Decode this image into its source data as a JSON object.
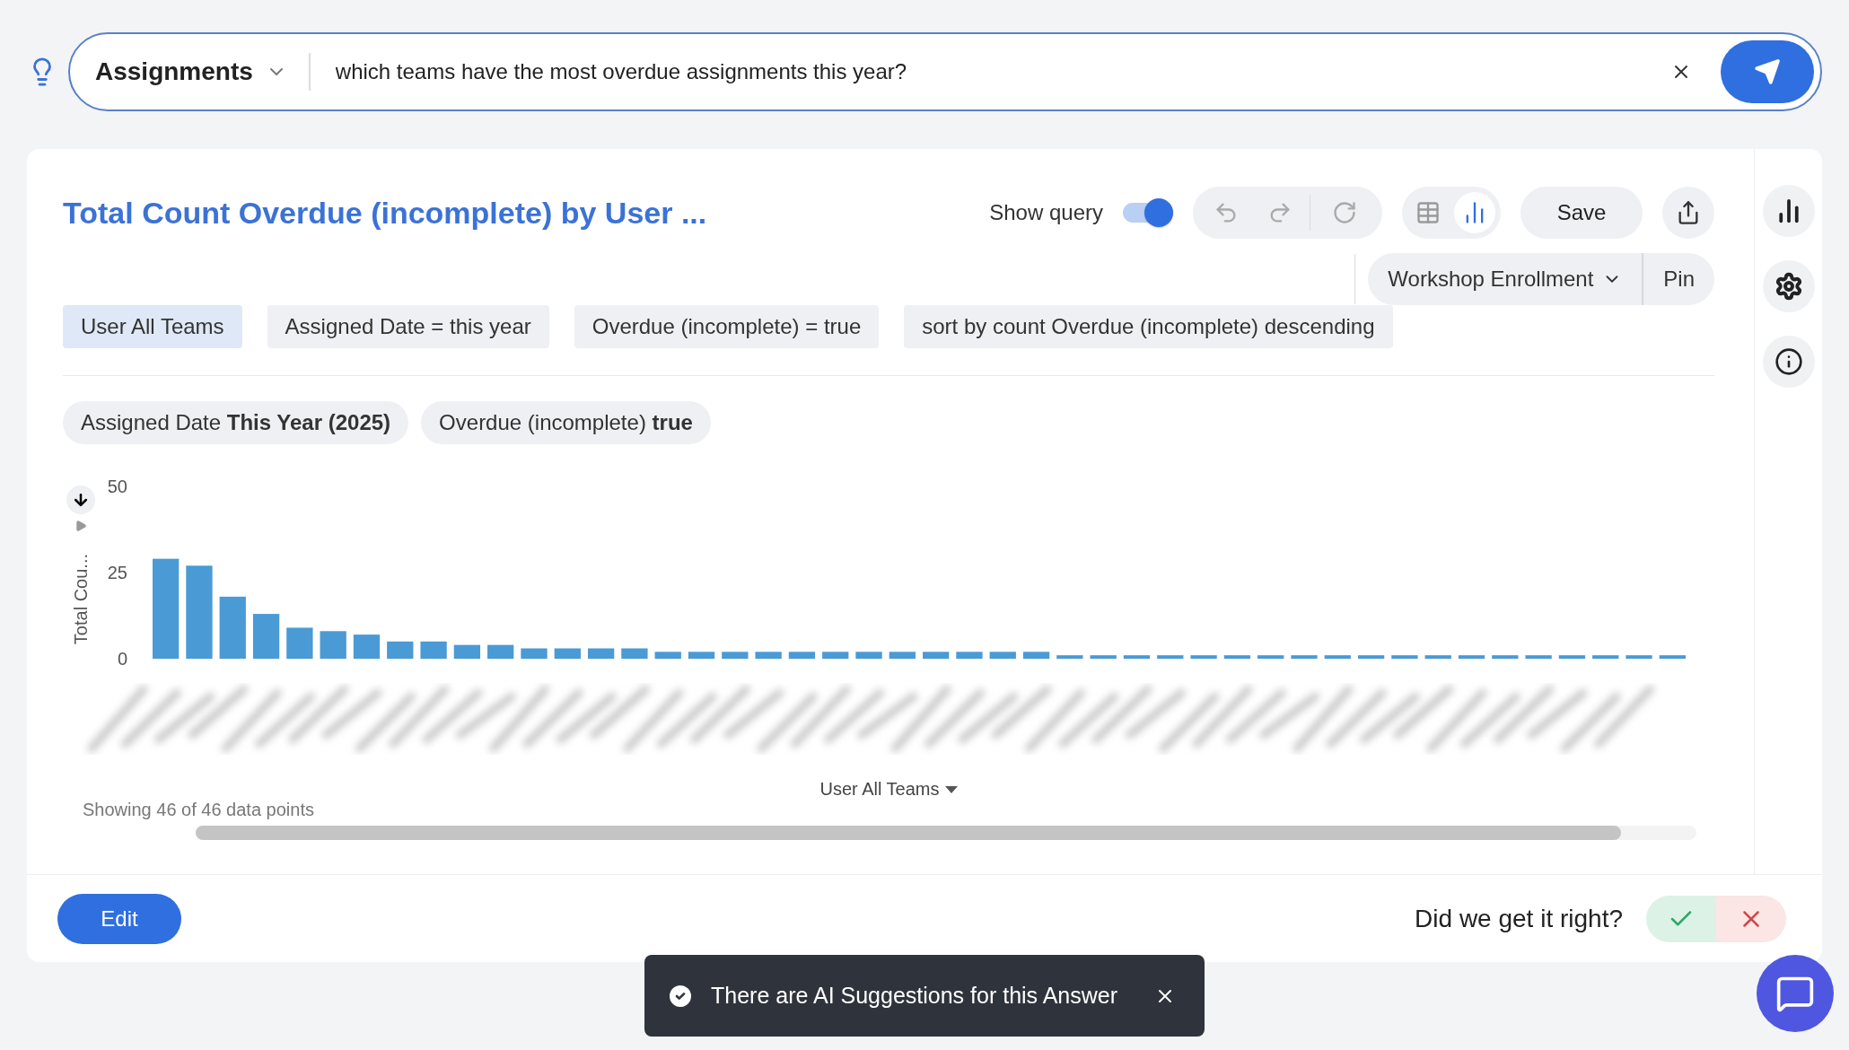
{
  "query_bar": {
    "source": "Assignments",
    "query": "which teams have the most overdue assignments this year?"
  },
  "answer": {
    "title": "Total Count Overdue (incomplete) by User ...",
    "show_query": {
      "label": "Show query",
      "on": true
    },
    "view_modes": [
      {
        "kind": "table",
        "selected": false
      },
      {
        "kind": "chart",
        "selected": true
      }
    ],
    "save": "Save",
    "liveboard": "Workshop Enrollment",
    "pin": "Pin",
    "query_tokens": [
      {
        "label": "User All Teams",
        "kind": "attribute"
      },
      {
        "label": "Assigned Date = this year",
        "kind": "filter"
      },
      {
        "label": "Overdue (incomplete) = true",
        "kind": "filter"
      },
      {
        "label": "sort by count Overdue (incomplete) descending",
        "kind": "sort"
      }
    ],
    "filters": [
      {
        "label": "Assigned Date **This Year (2025)**"
      },
      {
        "label": "Overdue (incomplete) **true**"
      }
    ],
    "chart_data": {
      "type": "bar",
      "xlabel": "User All Teams",
      "ylabel": "Total Cou...",
      "ylim": [
        0,
        50
      ],
      "yticks": [
        0,
        25,
        50
      ],
      "series": [
        {
          "color": "#4a9ad6",
          "values": [
            29,
            27,
            18,
            13,
            9,
            8,
            7,
            5,
            5,
            4,
            4,
            3,
            3,
            3,
            3,
            2,
            2,
            2,
            2,
            2,
            2,
            2,
            2,
            2,
            2,
            2,
            2,
            1,
            1,
            1,
            1,
            1,
            1,
            1,
            1,
            1,
            1,
            1,
            1,
            1,
            1,
            1,
            1,
            1,
            1,
            1
          ]
        }
      ]
    },
    "data_points": "Showing 46 of 46 data points",
    "edit": "Edit",
    "feedback": "Did we get it right?"
  },
  "toast": {
    "message": "There are AI Suggestions for this Answer"
  }
}
